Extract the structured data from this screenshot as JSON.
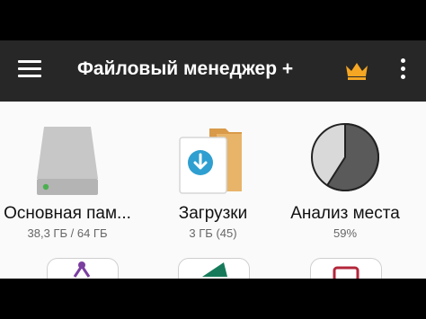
{
  "appbar": {
    "title": "Файловый менеджер +",
    "menu_icon": "hamburger-menu-icon",
    "premium_icon": "crown-icon",
    "more_icon": "more-vert-icon",
    "premium_color": "#f5a623"
  },
  "tiles": [
    {
      "label": "Основная пам...",
      "sub": "38,3 ГБ / 64 ГБ",
      "icon": "storage-drive-icon"
    },
    {
      "label": "Загрузки",
      "sub": "3 ГБ (45)",
      "icon": "downloads-folder-icon"
    },
    {
      "label": "Анализ места",
      "sub": "59%",
      "icon": "pie-chart-icon",
      "used_fraction": 0.59
    }
  ],
  "colors": {
    "appbar_bg": "#272727",
    "screen_bg": "#fafafa",
    "folder": "#e8b46a",
    "download_badge": "#2e9fd0",
    "drive": "#c7c7c7",
    "led": "#4caf50",
    "pie_used": "#5a5a5a",
    "pie_free": "#d9d9d9"
  }
}
